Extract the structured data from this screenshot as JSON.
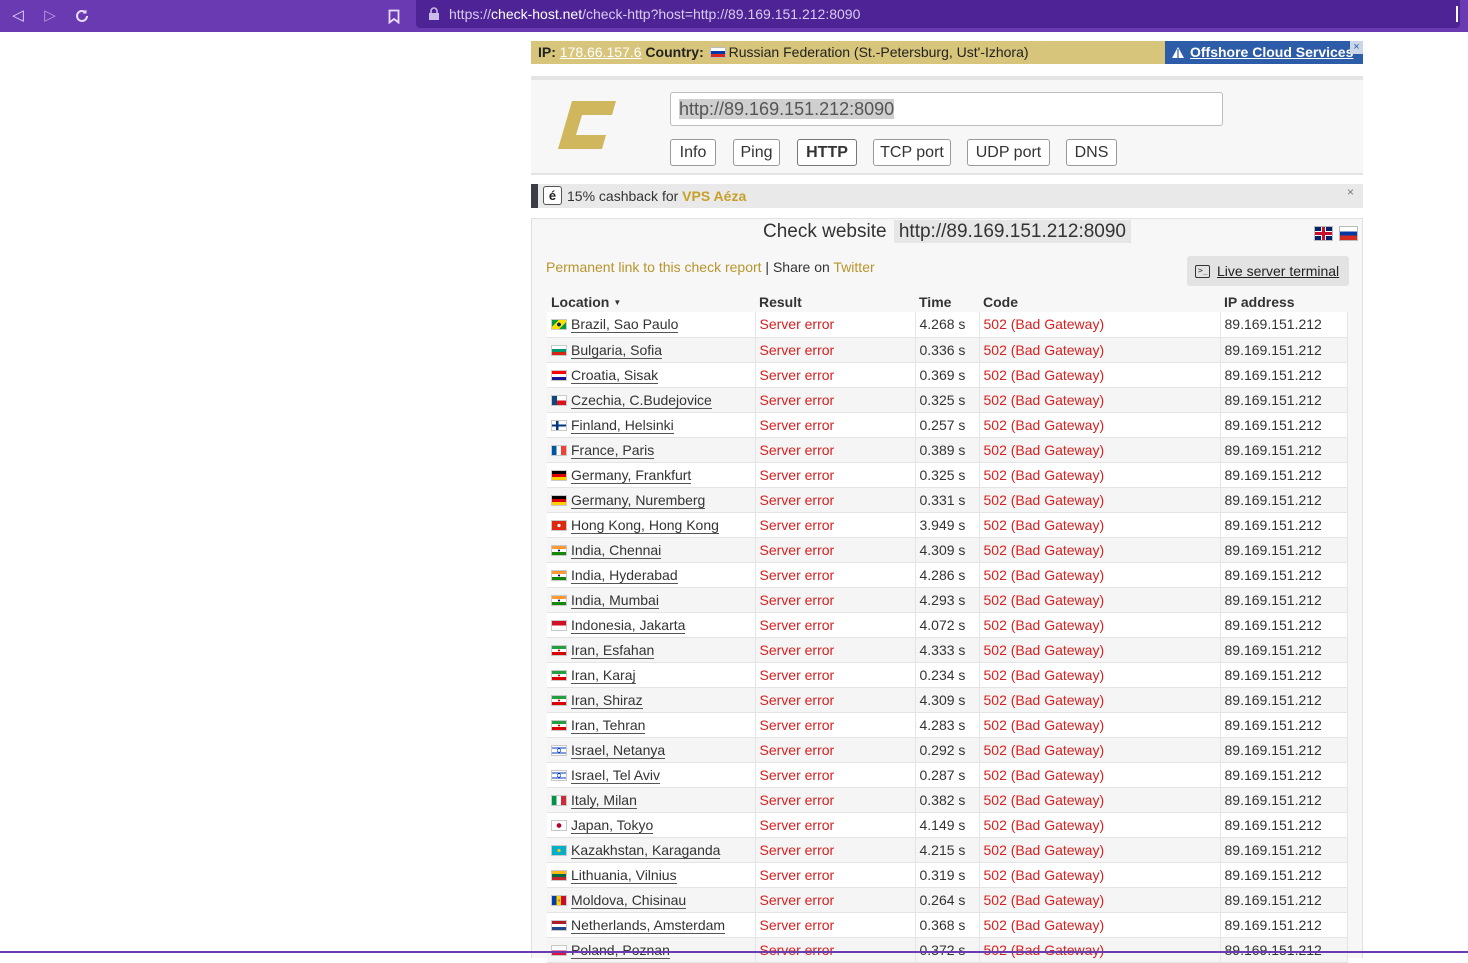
{
  "browser": {
    "url_prefix": "https://",
    "url_domain": "check-host.net",
    "url_path": "/check-http?host=http://89.169.151.212:8090"
  },
  "ipbar": {
    "ip_label": "IP:",
    "ip_value": "178.66.157.6",
    "country_label": "Country:",
    "country_value": "Russian Federation (St.-Petersburg, Ust'-Izhora)",
    "offshore_link": "Offshore Cloud Services",
    "close_glyph": "×"
  },
  "tool": {
    "host_value": "http://89.169.151.212:8090",
    "buttons": [
      "Info",
      "Ping",
      "HTTP",
      "TCP port",
      "UDP port",
      "DNS"
    ],
    "active_button": "HTTP"
  },
  "promo": {
    "icon_text": "é",
    "text": "15% cashback for ",
    "brand": "VPS Aéza",
    "close_glyph": "×"
  },
  "result": {
    "title_prefix": "Check website",
    "title_host": "http://89.169.151.212:8090",
    "permanent_link": "Permanent link to this check report",
    "separator": " | Share on ",
    "twitter": "Twitter",
    "terminal_icon": ">_",
    "terminal_label": "Live server terminal",
    "columns": [
      "Location",
      "Result",
      "Time",
      "Code",
      "IP address"
    ],
    "sort_glyph": "▼",
    "rows": [
      {
        "flag": "br",
        "location": "Brazil, Sao Paulo",
        "result": "Server error",
        "time": "4.268 s",
        "code": "502 (Bad Gateway)",
        "ip": "89.169.151.212"
      },
      {
        "flag": "bg",
        "location": "Bulgaria, Sofia",
        "result": "Server error",
        "time": "0.336 s",
        "code": "502 (Bad Gateway)",
        "ip": "89.169.151.212"
      },
      {
        "flag": "hr",
        "location": "Croatia, Sisak",
        "result": "Server error",
        "time": "0.369 s",
        "code": "502 (Bad Gateway)",
        "ip": "89.169.151.212"
      },
      {
        "flag": "cz",
        "location": "Czechia, C.Budejovice",
        "result": "Server error",
        "time": "0.325 s",
        "code": "502 (Bad Gateway)",
        "ip": "89.169.151.212"
      },
      {
        "flag": "fi",
        "location": "Finland, Helsinki",
        "result": "Server error",
        "time": "0.257 s",
        "code": "502 (Bad Gateway)",
        "ip": "89.169.151.212"
      },
      {
        "flag": "fr",
        "location": "France, Paris",
        "result": "Server error",
        "time": "0.389 s",
        "code": "502 (Bad Gateway)",
        "ip": "89.169.151.212"
      },
      {
        "flag": "de",
        "location": "Germany, Frankfurt",
        "result": "Server error",
        "time": "0.325 s",
        "code": "502 (Bad Gateway)",
        "ip": "89.169.151.212"
      },
      {
        "flag": "de",
        "location": "Germany, Nuremberg",
        "result": "Server error",
        "time": "0.331 s",
        "code": "502 (Bad Gateway)",
        "ip": "89.169.151.212"
      },
      {
        "flag": "hk",
        "location": "Hong Kong, Hong Kong",
        "result": "Server error",
        "time": "3.949 s",
        "code": "502 (Bad Gateway)",
        "ip": "89.169.151.212"
      },
      {
        "flag": "in",
        "location": "India, Chennai",
        "result": "Server error",
        "time": "4.309 s",
        "code": "502 (Bad Gateway)",
        "ip": "89.169.151.212"
      },
      {
        "flag": "in",
        "location": "India, Hyderabad",
        "result": "Server error",
        "time": "4.286 s",
        "code": "502 (Bad Gateway)",
        "ip": "89.169.151.212"
      },
      {
        "flag": "in",
        "location": "India, Mumbai",
        "result": "Server error",
        "time": "4.293 s",
        "code": "502 (Bad Gateway)",
        "ip": "89.169.151.212"
      },
      {
        "flag": "id",
        "location": "Indonesia, Jakarta",
        "result": "Server error",
        "time": "4.072 s",
        "code": "502 (Bad Gateway)",
        "ip": "89.169.151.212"
      },
      {
        "flag": "ir",
        "location": "Iran, Esfahan",
        "result": "Server error",
        "time": "4.333 s",
        "code": "502 (Bad Gateway)",
        "ip": "89.169.151.212"
      },
      {
        "flag": "ir",
        "location": "Iran, Karaj",
        "result": "Server error",
        "time": "0.234 s",
        "code": "502 (Bad Gateway)",
        "ip": "89.169.151.212"
      },
      {
        "flag": "ir",
        "location": "Iran, Shiraz",
        "result": "Server error",
        "time": "4.309 s",
        "code": "502 (Bad Gateway)",
        "ip": "89.169.151.212"
      },
      {
        "flag": "ir",
        "location": "Iran, Tehran",
        "result": "Server error",
        "time": "4.283 s",
        "code": "502 (Bad Gateway)",
        "ip": "89.169.151.212"
      },
      {
        "flag": "il",
        "location": "Israel, Netanya",
        "result": "Server error",
        "time": "0.292 s",
        "code": "502 (Bad Gateway)",
        "ip": "89.169.151.212"
      },
      {
        "flag": "il",
        "location": "Israel, Tel Aviv",
        "result": "Server error",
        "time": "0.287 s",
        "code": "502 (Bad Gateway)",
        "ip": "89.169.151.212"
      },
      {
        "flag": "it",
        "location": "Italy, Milan",
        "result": "Server error",
        "time": "0.382 s",
        "code": "502 (Bad Gateway)",
        "ip": "89.169.151.212"
      },
      {
        "flag": "jp",
        "location": "Japan, Tokyo",
        "result": "Server error",
        "time": "4.149 s",
        "code": "502 (Bad Gateway)",
        "ip": "89.169.151.212"
      },
      {
        "flag": "kz",
        "location": "Kazakhstan, Karaganda",
        "result": "Server error",
        "time": "4.215 s",
        "code": "502 (Bad Gateway)",
        "ip": "89.169.151.212"
      },
      {
        "flag": "lt",
        "location": "Lithuania, Vilnius",
        "result": "Server error",
        "time": "0.319 s",
        "code": "502 (Bad Gateway)",
        "ip": "89.169.151.212"
      },
      {
        "flag": "md",
        "location": "Moldova, Chisinau",
        "result": "Server error",
        "time": "0.264 s",
        "code": "502 (Bad Gateway)",
        "ip": "89.169.151.212"
      },
      {
        "flag": "nl",
        "location": "Netherlands, Amsterdam",
        "result": "Server error",
        "time": "0.368 s",
        "code": "502 (Bad Gateway)",
        "ip": "89.169.151.212"
      },
      {
        "flag": "pl",
        "location": "Poland, Poznan",
        "result": "Server error",
        "time": "0.372 s",
        "code": "502 (Bad Gateway)",
        "ip": "89.169.151.212"
      }
    ]
  }
}
